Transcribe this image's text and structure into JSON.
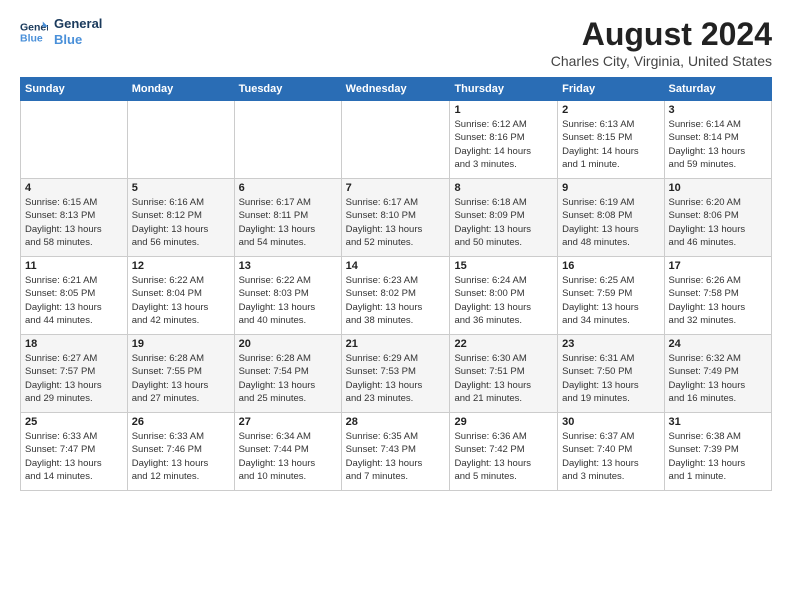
{
  "logo": {
    "line1": "General",
    "line2": "Blue"
  },
  "title": "August 2024",
  "subtitle": "Charles City, Virginia, United States",
  "weekdays": [
    "Sunday",
    "Monday",
    "Tuesday",
    "Wednesday",
    "Thursday",
    "Friday",
    "Saturday"
  ],
  "weeks": [
    [
      {
        "day": "",
        "info": ""
      },
      {
        "day": "",
        "info": ""
      },
      {
        "day": "",
        "info": ""
      },
      {
        "day": "",
        "info": ""
      },
      {
        "day": "1",
        "info": "Sunrise: 6:12 AM\nSunset: 8:16 PM\nDaylight: 14 hours\nand 3 minutes."
      },
      {
        "day": "2",
        "info": "Sunrise: 6:13 AM\nSunset: 8:15 PM\nDaylight: 14 hours\nand 1 minute."
      },
      {
        "day": "3",
        "info": "Sunrise: 6:14 AM\nSunset: 8:14 PM\nDaylight: 13 hours\nand 59 minutes."
      }
    ],
    [
      {
        "day": "4",
        "info": "Sunrise: 6:15 AM\nSunset: 8:13 PM\nDaylight: 13 hours\nand 58 minutes."
      },
      {
        "day": "5",
        "info": "Sunrise: 6:16 AM\nSunset: 8:12 PM\nDaylight: 13 hours\nand 56 minutes."
      },
      {
        "day": "6",
        "info": "Sunrise: 6:17 AM\nSunset: 8:11 PM\nDaylight: 13 hours\nand 54 minutes."
      },
      {
        "day": "7",
        "info": "Sunrise: 6:17 AM\nSunset: 8:10 PM\nDaylight: 13 hours\nand 52 minutes."
      },
      {
        "day": "8",
        "info": "Sunrise: 6:18 AM\nSunset: 8:09 PM\nDaylight: 13 hours\nand 50 minutes."
      },
      {
        "day": "9",
        "info": "Sunrise: 6:19 AM\nSunset: 8:08 PM\nDaylight: 13 hours\nand 48 minutes."
      },
      {
        "day": "10",
        "info": "Sunrise: 6:20 AM\nSunset: 8:06 PM\nDaylight: 13 hours\nand 46 minutes."
      }
    ],
    [
      {
        "day": "11",
        "info": "Sunrise: 6:21 AM\nSunset: 8:05 PM\nDaylight: 13 hours\nand 44 minutes."
      },
      {
        "day": "12",
        "info": "Sunrise: 6:22 AM\nSunset: 8:04 PM\nDaylight: 13 hours\nand 42 minutes."
      },
      {
        "day": "13",
        "info": "Sunrise: 6:22 AM\nSunset: 8:03 PM\nDaylight: 13 hours\nand 40 minutes."
      },
      {
        "day": "14",
        "info": "Sunrise: 6:23 AM\nSunset: 8:02 PM\nDaylight: 13 hours\nand 38 minutes."
      },
      {
        "day": "15",
        "info": "Sunrise: 6:24 AM\nSunset: 8:00 PM\nDaylight: 13 hours\nand 36 minutes."
      },
      {
        "day": "16",
        "info": "Sunrise: 6:25 AM\nSunset: 7:59 PM\nDaylight: 13 hours\nand 34 minutes."
      },
      {
        "day": "17",
        "info": "Sunrise: 6:26 AM\nSunset: 7:58 PM\nDaylight: 13 hours\nand 32 minutes."
      }
    ],
    [
      {
        "day": "18",
        "info": "Sunrise: 6:27 AM\nSunset: 7:57 PM\nDaylight: 13 hours\nand 29 minutes."
      },
      {
        "day": "19",
        "info": "Sunrise: 6:28 AM\nSunset: 7:55 PM\nDaylight: 13 hours\nand 27 minutes."
      },
      {
        "day": "20",
        "info": "Sunrise: 6:28 AM\nSunset: 7:54 PM\nDaylight: 13 hours\nand 25 minutes."
      },
      {
        "day": "21",
        "info": "Sunrise: 6:29 AM\nSunset: 7:53 PM\nDaylight: 13 hours\nand 23 minutes."
      },
      {
        "day": "22",
        "info": "Sunrise: 6:30 AM\nSunset: 7:51 PM\nDaylight: 13 hours\nand 21 minutes."
      },
      {
        "day": "23",
        "info": "Sunrise: 6:31 AM\nSunset: 7:50 PM\nDaylight: 13 hours\nand 19 minutes."
      },
      {
        "day": "24",
        "info": "Sunrise: 6:32 AM\nSunset: 7:49 PM\nDaylight: 13 hours\nand 16 minutes."
      }
    ],
    [
      {
        "day": "25",
        "info": "Sunrise: 6:33 AM\nSunset: 7:47 PM\nDaylight: 13 hours\nand 14 minutes."
      },
      {
        "day": "26",
        "info": "Sunrise: 6:33 AM\nSunset: 7:46 PM\nDaylight: 13 hours\nand 12 minutes."
      },
      {
        "day": "27",
        "info": "Sunrise: 6:34 AM\nSunset: 7:44 PM\nDaylight: 13 hours\nand 10 minutes."
      },
      {
        "day": "28",
        "info": "Sunrise: 6:35 AM\nSunset: 7:43 PM\nDaylight: 13 hours\nand 7 minutes."
      },
      {
        "day": "29",
        "info": "Sunrise: 6:36 AM\nSunset: 7:42 PM\nDaylight: 13 hours\nand 5 minutes."
      },
      {
        "day": "30",
        "info": "Sunrise: 6:37 AM\nSunset: 7:40 PM\nDaylight: 13 hours\nand 3 minutes."
      },
      {
        "day": "31",
        "info": "Sunrise: 6:38 AM\nSunset: 7:39 PM\nDaylight: 13 hours\nand 1 minute."
      }
    ]
  ]
}
